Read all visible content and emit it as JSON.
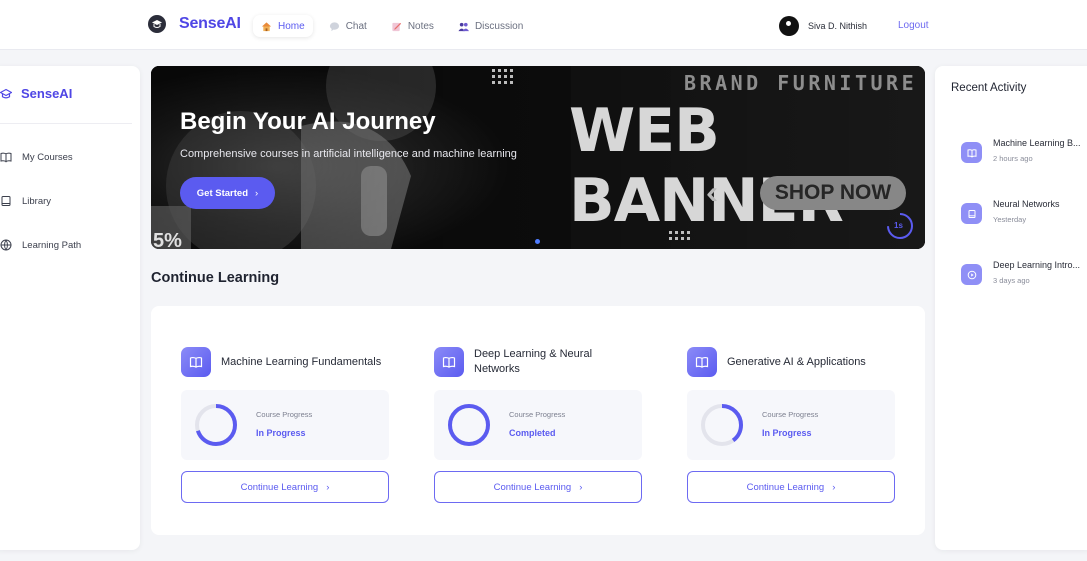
{
  "topbar": {
    "brand": "SenseAI",
    "nav": [
      {
        "label": "Home",
        "icon": "home-icon",
        "active": true
      },
      {
        "label": "Chat",
        "icon": "chat-icon"
      },
      {
        "label": "Notes",
        "icon": "notes-icon"
      },
      {
        "label": "Discussion",
        "icon": "discussion-icon"
      }
    ],
    "user_name": "Siva D. Nithish",
    "logout": "Logout"
  },
  "sidebar": {
    "brand": "SenseAI",
    "items": [
      {
        "label": "My Courses",
        "icon": "book-open-icon"
      },
      {
        "label": "Library",
        "icon": "book-icon"
      },
      {
        "label": "Learning Path",
        "icon": "globe-icon"
      }
    ]
  },
  "hero": {
    "title": "Begin Your AI Journey",
    "subtitle": "Comprehensive courses in artificial intelligence and machine learning",
    "cta": "Get Started",
    "banner_image_text": {
      "brand": "BRAND FURNITURE",
      "headline": "WEB BANNER",
      "button": "SHOP NOW",
      "badge": "5%"
    },
    "timer": "1s",
    "accent": "#5b5bf0"
  },
  "continue_learning": {
    "title": "Continue Learning",
    "courses": [
      {
        "title": "Machine Learning Fundamentals",
        "progress_label": "Course Progress",
        "status": "In Progress",
        "progress": 0.7,
        "button": "Continue Learning"
      },
      {
        "title": "Deep Learning & Neural Networks",
        "progress_label": "Course Progress",
        "status": "Completed",
        "progress": 1.0,
        "button": "Continue Learning"
      },
      {
        "title": "Generative AI & Applications",
        "progress_label": "Course Progress",
        "status": "In Progress",
        "progress": 0.4,
        "button": "Continue Learning"
      }
    ]
  },
  "activity": {
    "title": "Recent Activity",
    "items": [
      {
        "name": "Machine Learning B...",
        "time": "2 hours ago",
        "icon": "book-open-icon"
      },
      {
        "name": "Neural Networks",
        "time": "Yesterday",
        "icon": "book-icon"
      },
      {
        "name": "Deep Learning Intro...",
        "time": "3 days ago",
        "icon": "play-icon"
      }
    ]
  }
}
